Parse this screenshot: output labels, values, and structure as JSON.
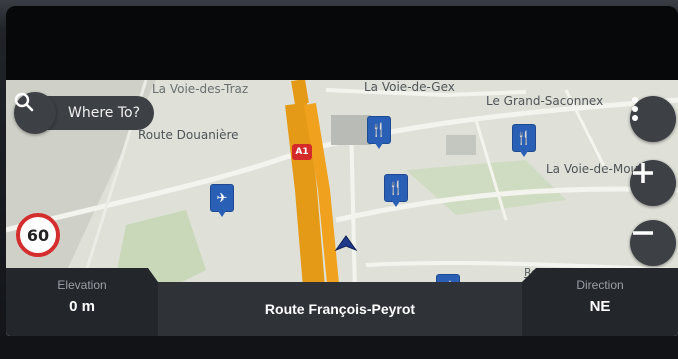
{
  "search": {
    "label": "Where To?"
  },
  "places": {
    "voie_des_traz": "La Voie-des-Traz",
    "voie_de_gex": "La Voie-de-Gex",
    "grand_saconnex": "Le Grand-Saconnex",
    "route_douaniere": "Route Douanière",
    "voie_de_moulins": "La Voie-de-Moulins",
    "route_peyrot_map": "Route Francois-Peyrot"
  },
  "highway": {
    "label": "A1"
  },
  "speed_limit": {
    "value": "60"
  },
  "info": {
    "elevation_label": "Elevation",
    "elevation_value": "0 m",
    "street": "Route François-Peyrot",
    "direction_label": "Direction",
    "direction_value": "NE"
  },
  "colors": {
    "route": "#f0a21e",
    "speed_ring": "#d32d2d",
    "poi": "#2a5fb6"
  },
  "icons": [
    "search-icon",
    "more-vert-icon",
    "zoom-in-icon",
    "zoom-out-icon",
    "airport-icon",
    "restaurant-icon",
    "position-arrow-icon"
  ]
}
